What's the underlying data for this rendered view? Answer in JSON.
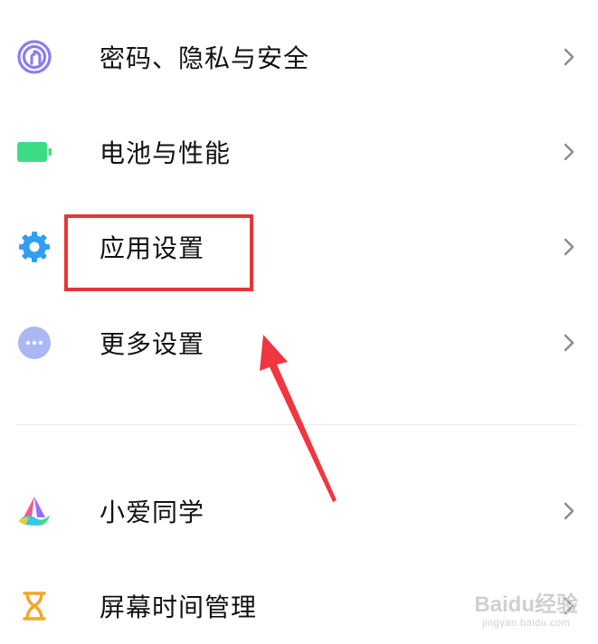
{
  "settings": {
    "items": [
      {
        "label": "密码、隐私与安全",
        "icon": "fingerprint-icon"
      },
      {
        "label": "电池与性能",
        "icon": "battery-icon"
      },
      {
        "label": "应用设置",
        "icon": "gear-icon"
      },
      {
        "label": "更多设置",
        "icon": "more-dots-icon"
      },
      {
        "label": "小爱同学",
        "icon": "xiaoai-assistant-icon"
      },
      {
        "label": "屏幕时间管理",
        "icon": "hourglass-icon"
      }
    ]
  },
  "annotation": {
    "highlight_color": "#e8353a",
    "highlighted_item": "应用设置"
  },
  "watermark": {
    "main": "Baidu经验",
    "sub": "jingyan.baidu.com"
  },
  "colors": {
    "fingerprint": "#8c7cf0",
    "battery": "#3ddc84",
    "gear": "#2f9ef4",
    "more": "#a9b7f5",
    "hourglass": "#f5a623"
  }
}
